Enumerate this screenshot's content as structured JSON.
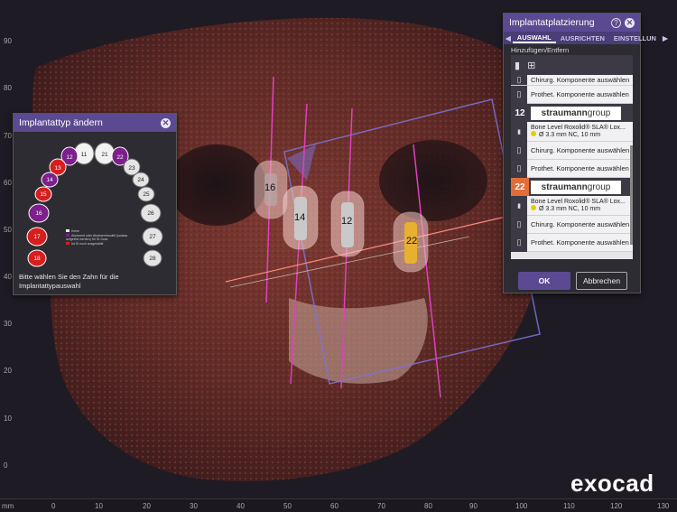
{
  "ruler": {
    "unit": "mm",
    "vertical": [
      "90",
      "80",
      "70",
      "60",
      "50",
      "40",
      "30",
      "20",
      "10",
      "0"
    ],
    "horizontal": [
      "0",
      "10",
      "20",
      "30",
      "40",
      "50",
      "60",
      "70",
      "80",
      "90",
      "100",
      "110",
      "120",
      "130"
    ]
  },
  "viewport": {
    "implants": [
      {
        "label": "16",
        "color": "gray"
      },
      {
        "label": "14",
        "color": "gray"
      },
      {
        "label": "12",
        "color": "gray"
      },
      {
        "label": "22",
        "color": "gold"
      }
    ]
  },
  "brand": "exocad",
  "left_panel": {
    "title": "Implantattyp ändern",
    "teeth_upper_right": [
      "11",
      "12",
      "13",
      "14",
      "15",
      "16",
      "17",
      "18"
    ],
    "teeth_upper_left": [
      "21",
      "22",
      "23",
      "24",
      "25",
      "26",
      "27",
      "28"
    ],
    "legend_line1": "Keine",
    "legend_line2": "Abutment oder Abutmentmodell (sodass aufgelöst werden) für DI-Scan",
    "legend_line3": "Ist ID noch ausgewählt",
    "instruction": "Bitte wählen Sie den Zahn für die Implantattypauswahl"
  },
  "right_panel": {
    "title": "Implantatplatzierung",
    "tabs": [
      "AUSWAHL",
      "AUSRICHTEN",
      "EINSTELLUN"
    ],
    "section_title": "Hinzufügen/Entfern",
    "rows": {
      "chir_label": "Chirurg. Komponente auswählen",
      "proth_label": "Prothet. Komponente auswählen"
    },
    "implants": [
      {
        "num": "12",
        "brand_a": "straumann",
        "brand_b": "group",
        "name": "Bone Level Roxolid® SLA® Lox...",
        "spec": "Ø 3.3 mm NC, 10 mm",
        "num_bg": "#3d3a45"
      },
      {
        "num": "22",
        "brand_a": "straumann",
        "brand_b": "group",
        "name": "Bone Level Roxolid® SLA® Lox...",
        "spec": "Ø 3.3 mm NC, 10 mm",
        "num_bg": "#e36d3a"
      }
    ],
    "ok_label": "OK",
    "cancel_label": "Abbrechen"
  }
}
